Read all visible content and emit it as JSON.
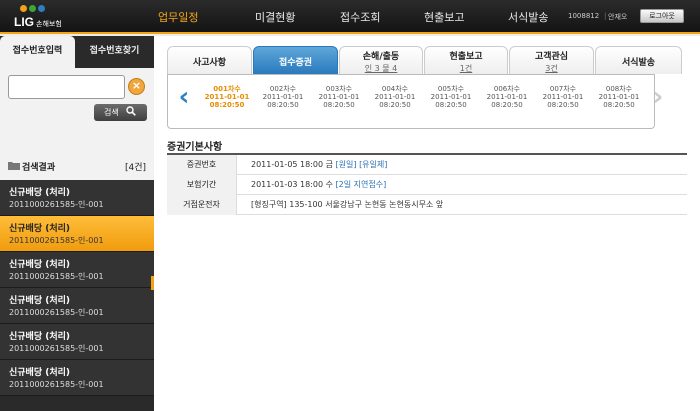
{
  "logo": {
    "text": "LIG",
    "sub": "손해보험",
    "dot_colors": [
      "#f0a21a",
      "#3fa536",
      "#2f7ec2"
    ]
  },
  "nav": [
    "업무일정",
    "미결현황",
    "접수조회",
    "현출보고",
    "서식발송"
  ],
  "user": {
    "id": "1008812",
    "name": "안재오",
    "logout": "로그아웃"
  },
  "sidebar": {
    "tabs": [
      "접수번호입력",
      "접수번호찾기"
    ],
    "search_value": "",
    "clear_icon": "×",
    "search_button": "검색",
    "result_label": "검색결과",
    "result_count": "[4건]",
    "items": [
      {
        "title": "신규배당 (처리)",
        "number": "2011000261585-인-001"
      },
      {
        "title": "신규배당 (처리)",
        "number": "2011000261585-인-001"
      },
      {
        "title": "신규배당 (처리)",
        "number": "2011000261585-인-001"
      },
      {
        "title": "신규배당 (처리)",
        "number": "2011000261585-인-001"
      },
      {
        "title": "신규배당 (처리)",
        "number": "2011000261585-인-001"
      },
      {
        "title": "신규배당 (처리)",
        "number": "2011000261585-인-001"
      }
    ]
  },
  "tabs": [
    {
      "label": "사고사항",
      "sub": ""
    },
    {
      "label": "접수증권",
      "sub": ""
    },
    {
      "label": "손해/출동",
      "sub": "인 3 물 4"
    },
    {
      "label": "현출보고",
      "sub": "1건"
    },
    {
      "label": "고객관심",
      "sub": "3건"
    },
    {
      "label": "서식발송",
      "sub": ""
    }
  ],
  "sequence": [
    {
      "label": "001차수",
      "date": "2011-01-01",
      "time": "08:20:50"
    },
    {
      "label": "002차수",
      "date": "2011-01-01",
      "time": "08:20:50"
    },
    {
      "label": "003차수",
      "date": "2011-01-01",
      "time": "08:20:50"
    },
    {
      "label": "004차수",
      "date": "2011-01-01",
      "time": "08:20:50"
    },
    {
      "label": "005차수",
      "date": "2011-01-01",
      "time": "08:20:50"
    },
    {
      "label": "006차수",
      "date": "2011-01-01",
      "time": "08:20:50"
    },
    {
      "label": "007차수",
      "date": "2011-01-01",
      "time": "08:20:50"
    },
    {
      "label": "008차수",
      "date": "2011-01-01",
      "time": "08:20:50"
    }
  ],
  "section_title": "증권기본사항",
  "rows": [
    {
      "key": "증권번호",
      "value": "2011-01-05 18:00 금",
      "links": [
        "[원일]",
        "[유일제]"
      ]
    },
    {
      "key": "보험기간",
      "value": "2011-01-03 18:00 수",
      "links": [
        "[2일 지연접수]"
      ]
    },
    {
      "key": "거점운전자",
      "value": "[형징구역] 135-100 서울강남구 논현동 논현동시무소 앞",
      "links": []
    }
  ],
  "colors": {
    "accent": "#f3a413",
    "active_tab": "#2a79bd",
    "link": "#2a6fb5"
  }
}
